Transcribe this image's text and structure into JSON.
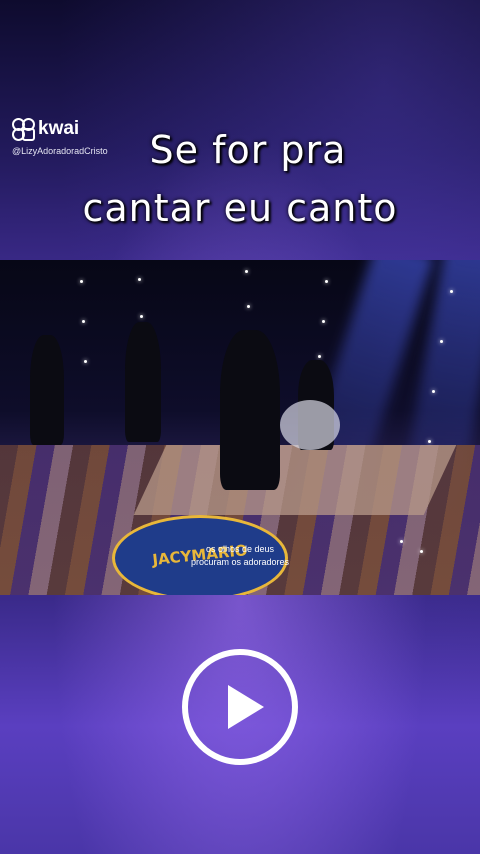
{
  "watermark": {
    "brand": "kwai",
    "handle": "@LizyAdoradoradCristo"
  },
  "caption": {
    "line1": "Se for pra",
    "line2": "cantar eu canto"
  },
  "video": {
    "stage_logo": "JACYMARIO",
    "subtitle_line1": "os olhos de deus",
    "subtitle_line2": "procuram os adoradores"
  },
  "controls": {
    "play_icon": "play-icon"
  }
}
